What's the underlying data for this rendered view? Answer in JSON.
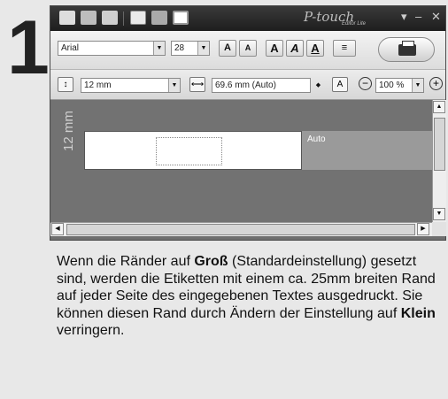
{
  "step_number": "1",
  "titlebar": {
    "brand": "P-touch",
    "brand_sub": "Editor Lite",
    "minimize": "‒",
    "close": "✕",
    "dropdown": "▾"
  },
  "toolbar": {
    "font_name": "Arial",
    "font_size": "28",
    "grow_font": "A",
    "shrink_font": "A",
    "bold": "A",
    "italic": "A",
    "underline": "A",
    "align": "≡"
  },
  "layout_bar": {
    "tape_width": "12 mm",
    "label_length": "69.6 mm (Auto)",
    "zoom": "100 %",
    "zoom_out": "−",
    "zoom_in": "+"
  },
  "canvas": {
    "ruler_label": "12 mm",
    "auto_label": "Auto"
  },
  "text": {
    "p1": "Wenn die Ränder auf ",
    "b1": "Groß",
    "p2": " (Standardeinstellung) gesetzt sind, werden die Etiketten mit einem ca. 25mm breiten Rand auf jeder Seite des eingegebenen Textes ausgedruckt. Sie können diesen Rand durch Ändern der Einstellung auf ",
    "b2": "Klein",
    "p3": " verringern."
  }
}
